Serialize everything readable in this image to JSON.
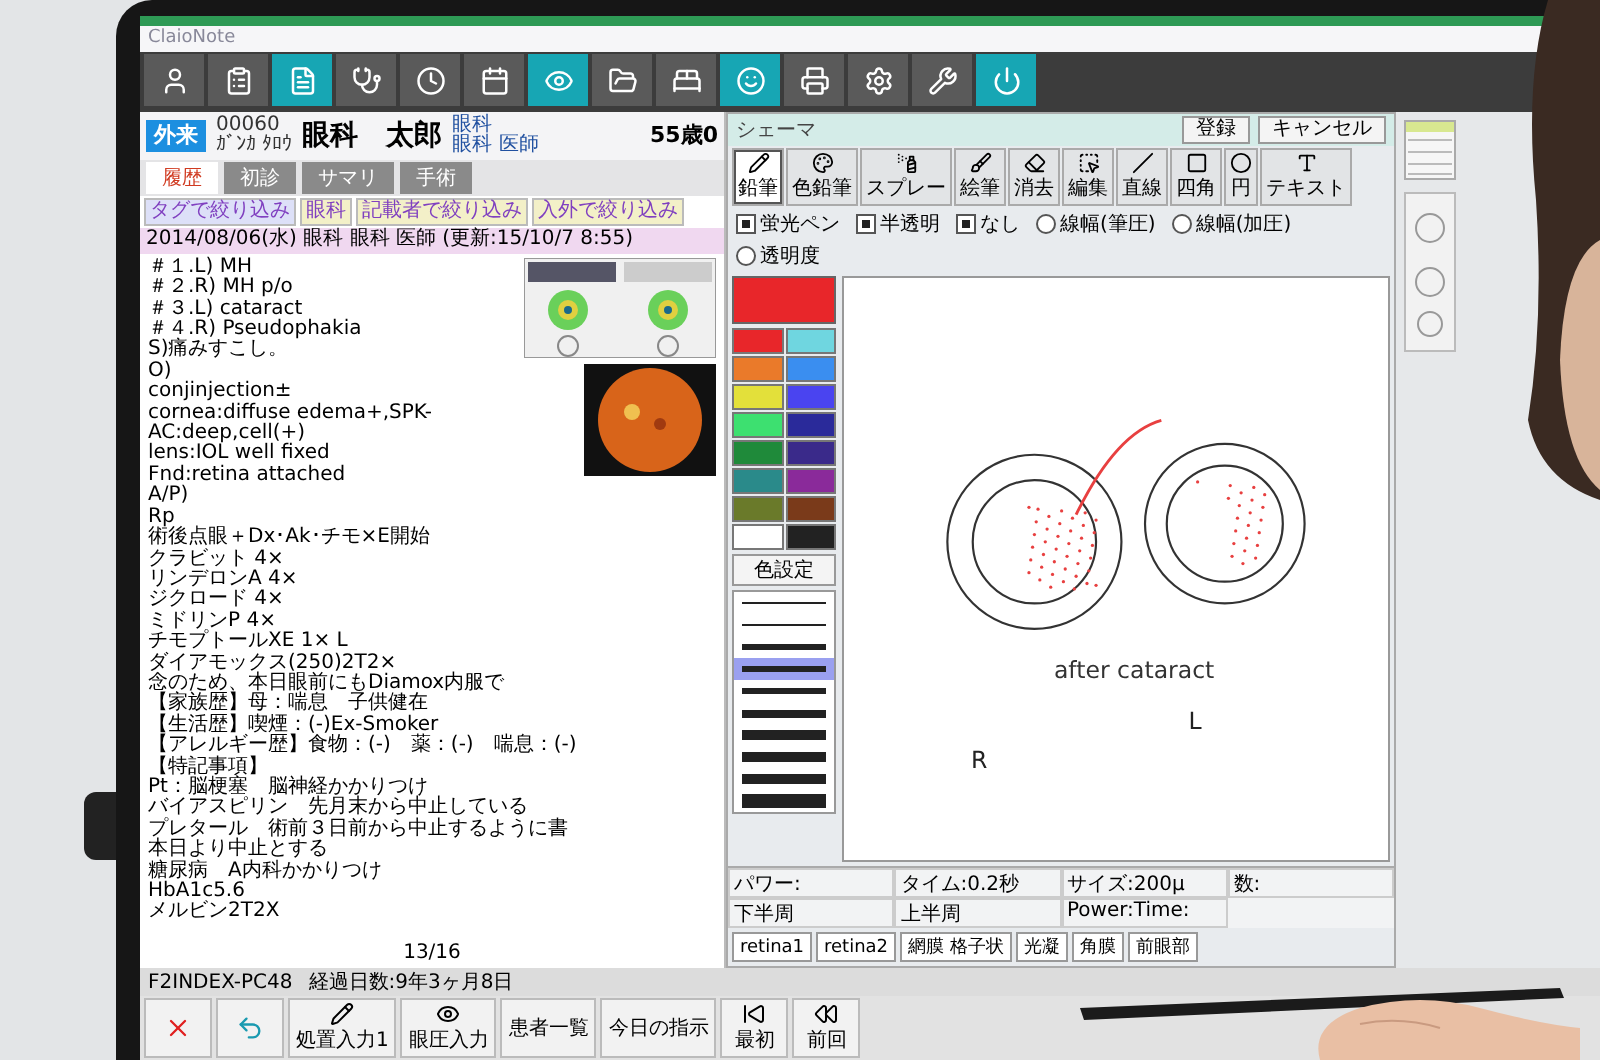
{
  "app": {
    "title": "ClaioNote"
  },
  "toolbar": [
    {
      "selected": false
    },
    {
      "selected": false
    },
    {
      "selected": true
    },
    {
      "selected": false
    },
    {
      "selected": false
    },
    {
      "selected": false
    },
    {
      "selected": true
    },
    {
      "selected": false
    },
    {
      "selected": false
    },
    {
      "selected": true
    },
    {
      "selected": false
    },
    {
      "selected": false
    },
    {
      "selected": false
    },
    {
      "selected": true
    }
  ],
  "patient": {
    "visit": "外来",
    "id": "00060",
    "kana": "ｶﾞﾝｶ ﾀﾛｳ",
    "name": "眼科　太郎",
    "department": "眼科",
    "doctor": "眼科 医師",
    "age": "55歳0"
  },
  "record_tabs": [
    {
      "label": "履歴",
      "selected": true
    },
    {
      "label": "初診",
      "selected": false
    },
    {
      "label": "サマリ",
      "selected": false
    },
    {
      "label": "手術",
      "selected": false
    }
  ],
  "filters": [
    "タグで絞り込み",
    "眼科",
    "記載者で絞り込み",
    "入外で絞り込み"
  ],
  "entry": {
    "header": "2014/08/06(水) 眼科 眼科 医師 (更新:15/10/7 8:55)",
    "diagnoses": [
      "＃１.L) MH",
      "＃２.R) MH p/o",
      "＃３.L) cataract",
      "＃４.R) Pseudophakia"
    ],
    "findings": [
      "S)痛みすこし。",
      "O)",
      "conjinjection±",
      "cornea:diffuse edema+,SPK-",
      "AC:deep,cell(+)",
      "lens:IOL well fixed",
      "Fnd:retina attached"
    ],
    "plan": [
      "A/P)",
      "Rp",
      "術後点眼＋Dx･Ak･チモ×E開始",
      "クラビット 4×",
      "リンデロンA 4×",
      "ジクロード 4×",
      "ミドリンP 4×",
      "チモプトールXE 1× L",
      "ダイアモックス(250)2T2×",
      "念のため、本日眼前にもDiamox内服で"
    ],
    "history": [
      "【家族歴】母：喘息　子供健在",
      "【生活歴】喫煙：(-)Ex-Smoker",
      "【アレルギー歴】食物：(-)　薬：(-)　喘息：(-)"
    ],
    "remarks": [
      "【特記事項】",
      "Pt：脳梗塞　脳神経かかりつけ",
      "バイアスピリン　先月末から中止している",
      "プレタール　術前３日前から中止するように書",
      "本日より中止とする",
      "糖尿病　A内科かかりつけ",
      "HbA1c5.6",
      "メルビン2T2X"
    ],
    "page": "13/16"
  },
  "status_bar": {
    "terminal": "F2INDEX-PC48",
    "elapsed": "経過日数:9年3ヶ月8日"
  },
  "bottom_buttons": [
    {
      "kind": "cancel"
    },
    {
      "kind": "undo"
    },
    {
      "kind": "pen",
      "label": "処置入力1"
    },
    {
      "kind": "eye",
      "label": "眼圧入力"
    },
    {
      "kind": "text",
      "label": "患者一覧"
    },
    {
      "kind": "text",
      "label": "今日の指示"
    },
    {
      "kind": "first",
      "label": "最初"
    },
    {
      "kind": "prev",
      "label": "前回"
    }
  ],
  "schema_dialog": {
    "title": "シェーマ",
    "actions": [
      "登録",
      "キャンセル"
    ],
    "tools": [
      {
        "label": "鉛筆",
        "selected": true
      },
      {
        "label": "色鉛筆",
        "selected": false
      },
      {
        "label": "スプレー",
        "selected": false
      },
      {
        "label": "絵筆",
        "selected": false
      },
      {
        "label": "消去",
        "selected": false
      },
      {
        "label": "編集",
        "selected": false
      },
      {
        "label": "直線",
        "selected": false
      },
      {
        "label": "四角",
        "selected": false
      },
      {
        "label": "円",
        "selected": false
      },
      {
        "label": "テキスト",
        "selected": false
      }
    ],
    "options": [
      {
        "kind": "checkbox",
        "label": "蛍光ペン",
        "checked": true
      },
      {
        "kind": "checkbox",
        "label": "半透明",
        "checked": true
      },
      {
        "kind": "checkbox",
        "label": "なし",
        "checked": true
      },
      {
        "kind": "radio",
        "label": "線幅(筆圧)",
        "checked": false
      },
      {
        "kind": "radio",
        "label": "線幅(加圧)",
        "checked": false
      },
      {
        "kind": "radio",
        "label": "透明度",
        "checked": false
      }
    ],
    "palette": [
      {
        "color": "#e8262a"
      },
      {
        "color": "#6fd6e0"
      },
      {
        "color": "#ea7a2a"
      },
      {
        "color": "#3a8ef0"
      },
      {
        "color": "#e3e03a"
      },
      {
        "color": "#4a44f0"
      },
      {
        "color": "#3de070"
      },
      {
        "color": "#2a2a9a"
      },
      {
        "color": "#1f8a3a"
      },
      {
        "color": "#3a2a8a"
      },
      {
        "color": "#2a8a8a"
      },
      {
        "color": "#8a2a9a"
      },
      {
        "color": "#6a7a2a"
      },
      {
        "color": "#7a3a1a"
      },
      {
        "color": "#ffffff"
      },
      {
        "color": "#222222"
      }
    ],
    "color_settings": "色設定",
    "line_widths": [
      {
        "selected": false
      },
      {
        "selected": false
      },
      {
        "selected": false
      },
      {
        "selected": true
      },
      {
        "selected": false
      },
      {
        "selected": false
      },
      {
        "selected": false
      },
      {
        "selected": false
      },
      {
        "selected": false
      },
      {
        "selected": false
      }
    ],
    "canvas": {
      "caption": "after cataract",
      "right_label": "R",
      "left_label": "L"
    },
    "fields": [
      "パワー:",
      "タイム:0.2秒",
      "サイズ:200μ",
      "数:",
      "下半周",
      "上半周",
      "Power:Time:"
    ],
    "presets": [
      "retina1",
      "retina2",
      "網膜 格子状",
      "光凝",
      "角膜",
      "前眼部"
    ]
  }
}
